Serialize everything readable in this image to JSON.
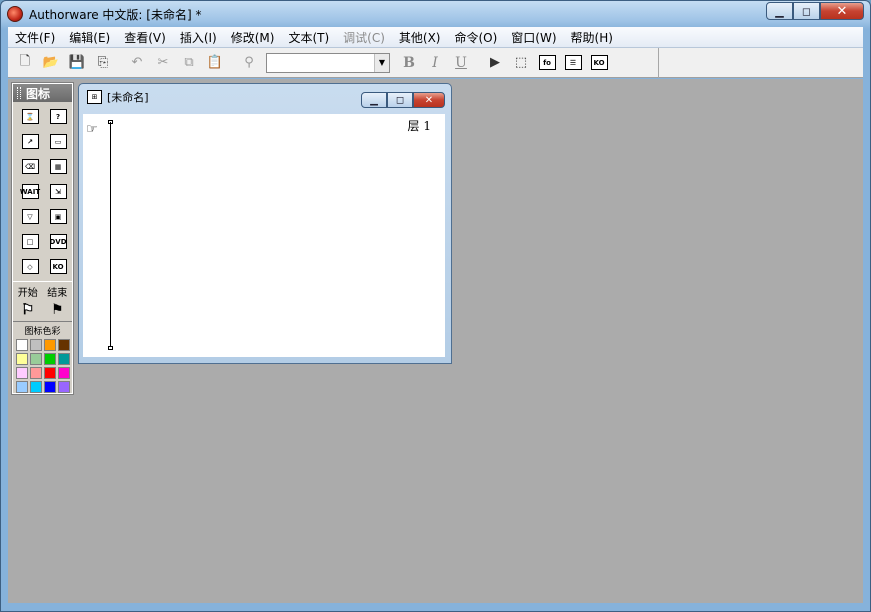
{
  "window": {
    "title": "Authorware 中文版: [未命名] *",
    "min": "▁",
    "max": "◻",
    "close": "✕"
  },
  "menu": [
    {
      "label": "文件(F)",
      "enabled": true
    },
    {
      "label": "编辑(E)",
      "enabled": true
    },
    {
      "label": "查看(V)",
      "enabled": true
    },
    {
      "label": "插入(I)",
      "enabled": true
    },
    {
      "label": "修改(M)",
      "enabled": true
    },
    {
      "label": "文本(T)",
      "enabled": true
    },
    {
      "label": "调试(C)",
      "enabled": false
    },
    {
      "label": "其他(X)",
      "enabled": true
    },
    {
      "label": "命令(O)",
      "enabled": true
    },
    {
      "label": "窗口(W)",
      "enabled": true
    },
    {
      "label": "帮助(H)",
      "enabled": true
    }
  ],
  "toolbar": {
    "new": "🗋",
    "open": "📂",
    "save_all": "💾",
    "import": "⎘",
    "undo": "↶",
    "cut": "✂",
    "copy": "⧉",
    "paste": "📋",
    "find": "⚲",
    "font_value": "",
    "dropdown_arrow": "▼",
    "bold": "B",
    "italic": "I",
    "underline": "U",
    "run": "▶",
    "control_panel": "⬚",
    "functions": "fo",
    "variables": "☰",
    "knowledge_objects": "KO"
  },
  "palette": {
    "title": "图标",
    "icons": [
      {
        "name": "display-icon",
        "glyph": "⌛"
      },
      {
        "name": "interaction-icon",
        "glyph": "?"
      },
      {
        "name": "motion-icon",
        "glyph": "↗"
      },
      {
        "name": "framework-icon",
        "glyph": "▭"
      },
      {
        "name": "erase-icon",
        "glyph": "⌫"
      },
      {
        "name": "navigate-icon",
        "glyph": "▦"
      },
      {
        "name": "wait-icon",
        "glyph": "WAIT"
      },
      {
        "name": "calculation-icon",
        "glyph": "⇲"
      },
      {
        "name": "decision-icon",
        "glyph": "▽"
      },
      {
        "name": "digital-movie-icon",
        "glyph": "▣"
      },
      {
        "name": "map-icon",
        "glyph": "□"
      },
      {
        "name": "dvd-icon",
        "glyph": "DVD"
      },
      {
        "name": "sound-icon",
        "glyph": "◇"
      },
      {
        "name": "ko-icon",
        "glyph": "KO"
      }
    ],
    "start_label": "开始",
    "end_label": "结束",
    "start_flag": "⚑",
    "end_flag": "⚑",
    "colors_label": "图标色彩",
    "colors": [
      "#ffffff",
      "#c0c0c0",
      "#ff9900",
      "#663300",
      "#ffff99",
      "#99cc99",
      "#00cc00",
      "#009999",
      "#ffccff",
      "#ff9999",
      "#ff0000",
      "#ff00cc",
      "#99ccff",
      "#00ccff",
      "#0000ff",
      "#9966ff"
    ]
  },
  "child": {
    "title": "[未命名]",
    "icon": "⊞",
    "hand": "☞",
    "layer": "层 1",
    "min": "▁",
    "max": "◻",
    "close": "✕"
  }
}
